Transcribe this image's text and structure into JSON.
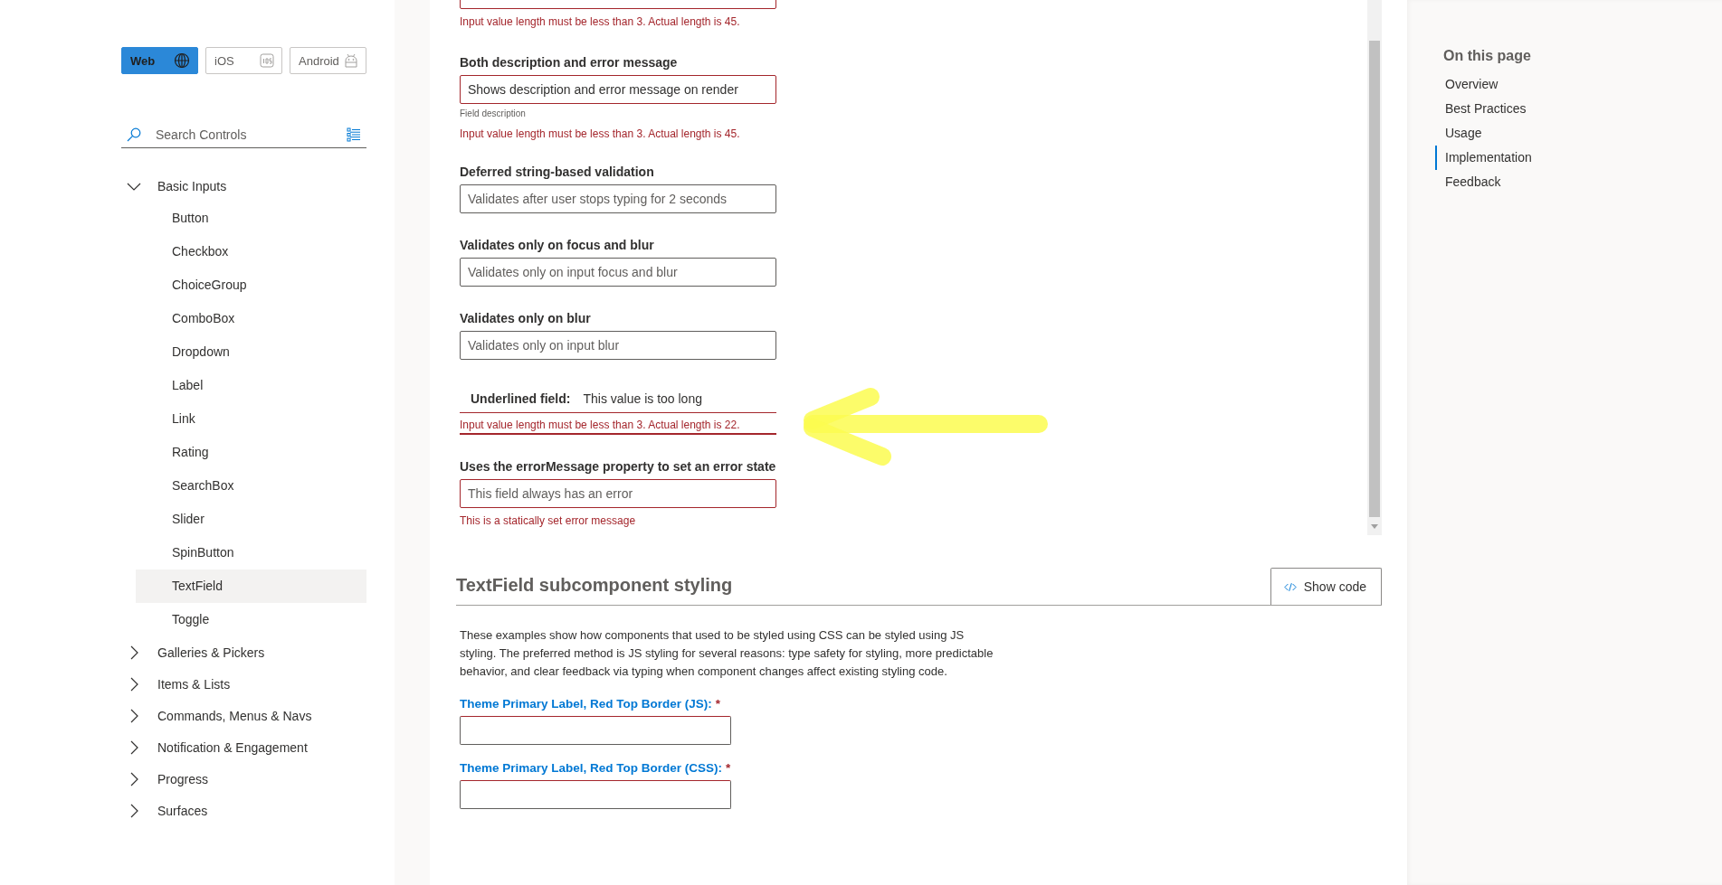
{
  "platforms": [
    {
      "label": "Web",
      "kind": "web",
      "selected": true
    },
    {
      "label": "iOS",
      "kind": "ios",
      "selected": false
    },
    {
      "label": "Android",
      "kind": "android",
      "selected": false
    }
  ],
  "search": {
    "placeholder": "Search Controls"
  },
  "nav": [
    {
      "label": "Basic Inputs",
      "expanded": true,
      "children": [
        {
          "label": "Button",
          "selected": false
        },
        {
          "label": "Checkbox",
          "selected": false
        },
        {
          "label": "ChoiceGroup",
          "selected": false
        },
        {
          "label": "ComboBox",
          "selected": false
        },
        {
          "label": "Dropdown",
          "selected": false
        },
        {
          "label": "Label",
          "selected": false
        },
        {
          "label": "Link",
          "selected": false
        },
        {
          "label": "Rating",
          "selected": false
        },
        {
          "label": "SearchBox",
          "selected": false
        },
        {
          "label": "Slider",
          "selected": false
        },
        {
          "label": "SpinButton",
          "selected": false
        },
        {
          "label": "TextField",
          "selected": true
        },
        {
          "label": "Toggle",
          "selected": false
        }
      ]
    },
    {
      "label": "Galleries & Pickers",
      "expanded": false
    },
    {
      "label": "Items & Lists",
      "expanded": false
    },
    {
      "label": "Commands, Menus & Navs",
      "expanded": false
    },
    {
      "label": "Notification & Engagement",
      "expanded": false
    },
    {
      "label": "Progress",
      "expanded": false
    },
    {
      "label": "Surfaces",
      "expanded": false
    }
  ],
  "examples": [
    {
      "kind": "cut",
      "invalid": true,
      "error_message": "Input value length must be less than 3. Actual length is 45."
    },
    {
      "kind": "boxed",
      "label": "Both description and error message",
      "value": "Shows description and error message on render",
      "invalid": true,
      "description": "Field description",
      "error_message": "Input value length must be less than 3. Actual length is 45."
    },
    {
      "kind": "boxed",
      "label": "Deferred string-based validation",
      "placeholder": "Validates after user stops typing for 2 seconds",
      "invalid": false
    },
    {
      "kind": "boxed",
      "label": "Validates only on focus and blur",
      "placeholder": "Validates only on input focus and blur",
      "invalid": false
    },
    {
      "kind": "boxed",
      "label": "Validates only on blur",
      "placeholder": "Validates only on input blur",
      "invalid": false
    },
    {
      "kind": "underlined",
      "label": "Underlined field:",
      "value": "This value is too long",
      "invalid": true,
      "error_message": "Input value length must be less than 3. Actual length is 22."
    },
    {
      "kind": "boxed",
      "label": "Uses the errorMessage property to set an error state",
      "placeholder": "This field always has an error",
      "invalid": true,
      "error_message": "This is a statically set error message"
    }
  ],
  "section": {
    "title": "TextField subcomponent styling",
    "button": "Show code",
    "paragraph": "These examples show how components that used to be styled using CSS can be styled using JS styling. The preferred method is JS styling for several reasons: type safety for styling, more predictable behavior, and clear feedback via typing when component changes affect existing styling code.",
    "fields": [
      {
        "label": "Theme Primary Label, Red Top Border (JS):",
        "required_mark": "*"
      },
      {
        "label": "Theme Primary Label, Red Top Border (CSS):",
        "required_mark": "*"
      }
    ]
  },
  "on_this_page": {
    "title": "On this page",
    "items": [
      {
        "label": "Overview",
        "selected": false
      },
      {
        "label": "Best Practices",
        "selected": false
      },
      {
        "label": "Usage",
        "selected": false
      },
      {
        "label": "Implementation",
        "selected": true
      },
      {
        "label": "Feedback",
        "selected": false
      }
    ]
  }
}
